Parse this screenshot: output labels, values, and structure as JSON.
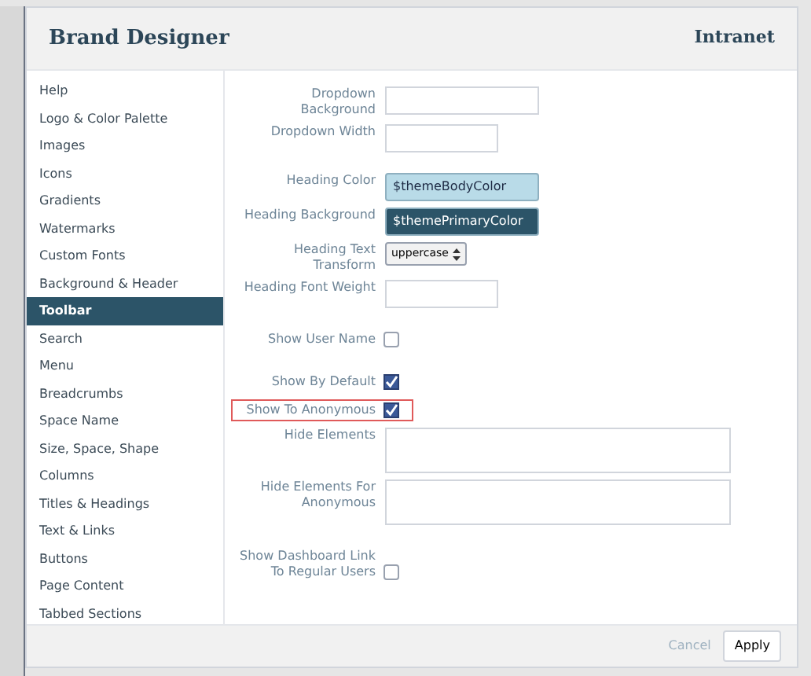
{
  "dialog": {
    "title": "Brand Designer",
    "brand": "Intranet"
  },
  "sidebar": {
    "items": [
      {
        "label": "Help",
        "selected": false
      },
      {
        "label": "Logo & Color Palette",
        "selected": false
      },
      {
        "label": "Images",
        "selected": false
      },
      {
        "label": "Icons",
        "selected": false
      },
      {
        "label": "Gradients",
        "selected": false
      },
      {
        "label": "Watermarks",
        "selected": false
      },
      {
        "label": "Custom Fonts",
        "selected": false
      },
      {
        "label": "Background & Header",
        "selected": false
      },
      {
        "label": "Toolbar",
        "selected": true
      },
      {
        "label": "Search",
        "selected": false
      },
      {
        "label": "Menu",
        "selected": false
      },
      {
        "label": "Breadcrumbs",
        "selected": false
      },
      {
        "label": "Space Name",
        "selected": false
      },
      {
        "label": "Size, Space, Shape",
        "selected": false
      },
      {
        "label": "Columns",
        "selected": false
      },
      {
        "label": "Titles & Headings",
        "selected": false
      },
      {
        "label": "Text & Links",
        "selected": false
      },
      {
        "label": "Buttons",
        "selected": false
      },
      {
        "label": "Page Content",
        "selected": false
      },
      {
        "label": "Tabbed Sections",
        "selected": false
      }
    ]
  },
  "form": {
    "sections": [
      [
        {
          "kind": "wideinput",
          "label": "Dropdown Background"
        },
        {
          "kind": "input",
          "label": "Dropdown Width"
        }
      ],
      [
        {
          "kind": "color",
          "label": "Heading Color",
          "value": "$themeBodyColor",
          "color": "#b9dbe8"
        },
        {
          "kind": "color",
          "label": "Heading Background",
          "value": "$themePrimaryColor",
          "color": "#2c5468"
        },
        {
          "kind": "select",
          "label": "Heading Text Transform",
          "value": "uppercase"
        },
        {
          "kind": "input",
          "label": "Heading Font Weight"
        }
      ],
      [
        {
          "kind": "checkbox",
          "label": "Show User Name",
          "checked": false
        }
      ],
      [
        {
          "kind": "checkbox",
          "label": "Show By Default",
          "checked": true
        },
        {
          "kind": "checkbox",
          "label": "Show To Anonymous",
          "checked": true,
          "highlighted": true
        },
        {
          "kind": "textarea",
          "label": "Hide Elements"
        },
        {
          "kind": "textarea",
          "label": "Hide Elements For Anonymous"
        }
      ],
      [
        {
          "kind": "checkbox",
          "label": "Show Dashboard Link To Regular Users",
          "checked": false
        }
      ]
    ]
  },
  "footer": {
    "cancel": "Cancel",
    "apply": "Apply"
  }
}
